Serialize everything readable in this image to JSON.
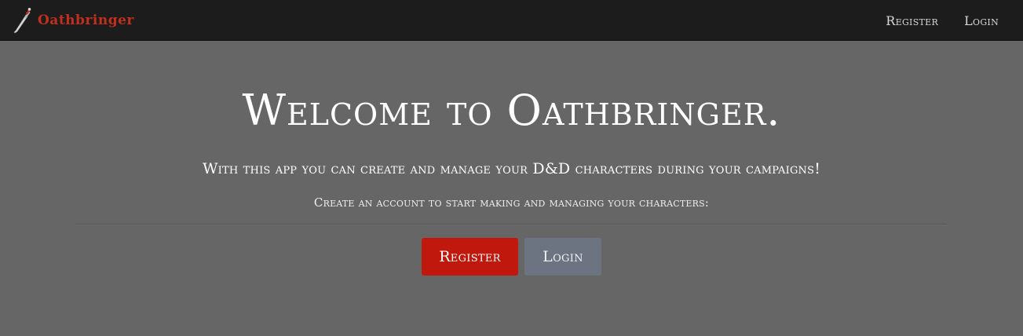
{
  "navbar": {
    "brand_text": "Oathbringer",
    "brand_icon": "sword-icon",
    "links": {
      "register": "Register",
      "login": "Login"
    }
  },
  "hero": {
    "title": "Welcome to Oathbringer.",
    "lead": "With this app you can create and manage your D&D characters during your campaigns!",
    "subtext": "Create an account to start making and managing your characters:",
    "buttons": {
      "register": "Register",
      "login": "Login"
    }
  },
  "colors": {
    "navbar_bg": "#1c1c1c",
    "page_bg": "#666666",
    "brand": "#c0301c",
    "register_button": "#c0180c",
    "login_button": "#6b7480"
  }
}
